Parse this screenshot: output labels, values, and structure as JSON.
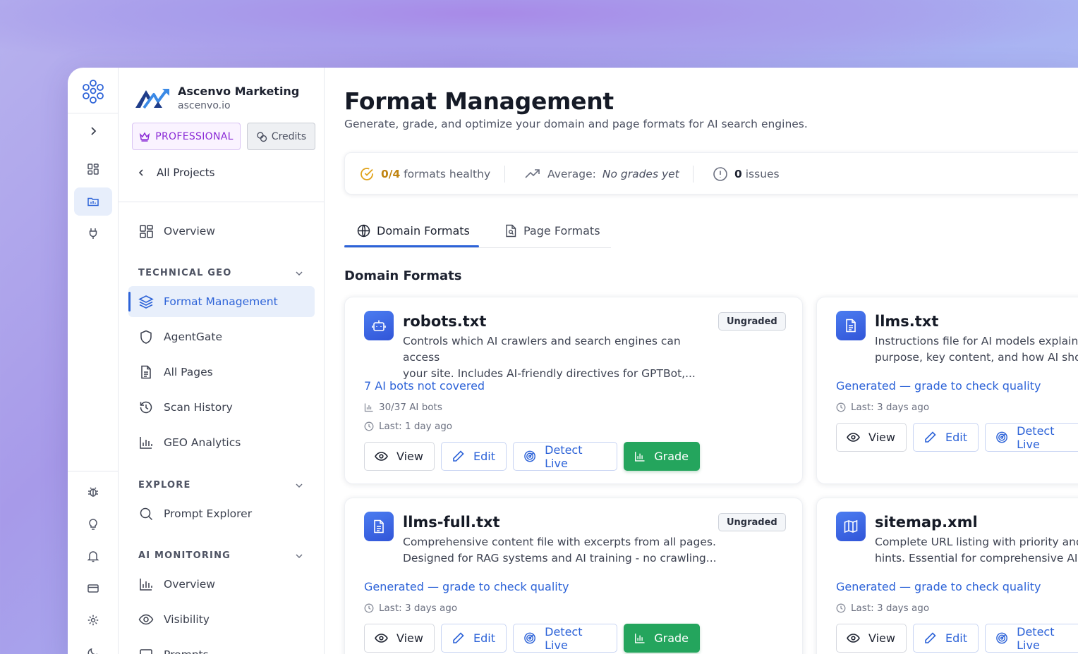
{
  "org": {
    "name": "Ascenvo Marketing",
    "domain": "ascenvo.io"
  },
  "plan_label": "PROFESSIONAL",
  "credits_label": "Credits",
  "all_projects_label": "All Projects",
  "nav": {
    "overview": "Overview",
    "technical_geo_heading": "TECHNICAL GEO",
    "technical_geo": [
      "Format Management",
      "AgentGate",
      "All Pages",
      "Scan History",
      "GEO Analytics"
    ],
    "explore_heading": "EXPLORE",
    "explore": [
      "Prompt Explorer"
    ],
    "ai_monitoring_heading": "AI MONITORING",
    "ai_monitoring": [
      "Overview",
      "Visibility",
      "Prompts"
    ]
  },
  "page": {
    "title": "Format Management",
    "subtitle": "Generate, grade, and optimize your domain and page formats for AI search engines."
  },
  "stats": {
    "healthy_count": "0/4",
    "healthy_label": "formats healthy",
    "average_label": "Average:",
    "average_value": "No grades yet",
    "issues_count": "0",
    "issues_label": "issues"
  },
  "tabs": [
    "Domain Formats",
    "Page Formats"
  ],
  "section_title": "Domain Formats",
  "actions": {
    "view": "View",
    "edit": "Edit",
    "detect": "Detect Live",
    "grade": "Grade"
  },
  "cards": [
    {
      "title": "robots.txt",
      "desc_line1": "Controls which AI crawlers and search engines can access",
      "desc_line2": "your site. Includes AI-friendly directives for GPTBot,...",
      "badge": "Ungraded",
      "status": "7 AI bots not covered",
      "meta_bots": "30/37 AI bots",
      "meta_last": "Last: 1 day ago"
    },
    {
      "title": "llms.txt",
      "desc_line1": "Instructions file for AI models explaining",
      "desc_line2": "purpose, key content, and how AI should",
      "status": "Generated — grade to check quality",
      "meta_last": "Last: 3 days ago"
    },
    {
      "title": "llms-full.txt",
      "desc_line1": "Comprehensive content file with excerpts from all pages.",
      "desc_line2": "Designed for RAG systems and AI training - no crawling...",
      "badge": "Ungraded",
      "status": "Generated — grade to check quality",
      "meta_last": "Last: 3 days ago"
    },
    {
      "title": "sitemap.xml",
      "desc_line1": "Complete URL listing with priority and",
      "desc_line2": "hints. Essential for comprehensive AI c",
      "status": "Generated — grade to check quality",
      "meta_last": "Last: 3 days ago"
    }
  ],
  "colors": {
    "accent": "#2d63d8",
    "success": "#24a55d",
    "warning": "#e0a21a",
    "plan": "#8a2ad6"
  }
}
